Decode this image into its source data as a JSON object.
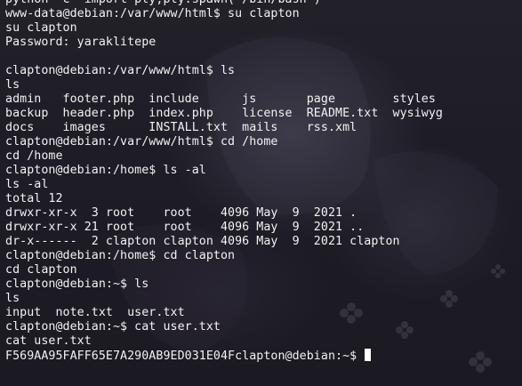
{
  "terminal": {
    "lines": [
      "python -c 'import pty;pty.spawn(\"/bin/bash\")'",
      "www-data@debian:/var/www/html$ su clapton",
      "su clapton",
      "Password: yaraklitepe",
      "",
      "clapton@debian:/var/www/html$ ls",
      "ls",
      "admin   footer.php  include      js       page        styles",
      "backup  header.php  index.php    license  README.txt  wysiwyg",
      "docs    images      INSTALL.txt  mails    rss.xml",
      "clapton@debian:/var/www/html$ cd /home",
      "cd /home",
      "clapton@debian:/home$ ls -al",
      "ls -al",
      "total 12",
      "drwxr-xr-x  3 root    root    4096 May  9  2021 .",
      "drwxr-xr-x 21 root    root    4096 May  9  2021 ..",
      "dr-x------  2 clapton clapton 4096 May  9  2021 clapton",
      "clapton@debian:/home$ cd clapton",
      "cd clapton",
      "clapton@debian:~$ ls",
      "ls",
      "input  note.txt  user.txt",
      "clapton@debian:~$ cat user.txt",
      "cat user.txt",
      "F569AA95FAFF65E7A290AB9ED031E04Fclapton@debian:~$ "
    ]
  }
}
